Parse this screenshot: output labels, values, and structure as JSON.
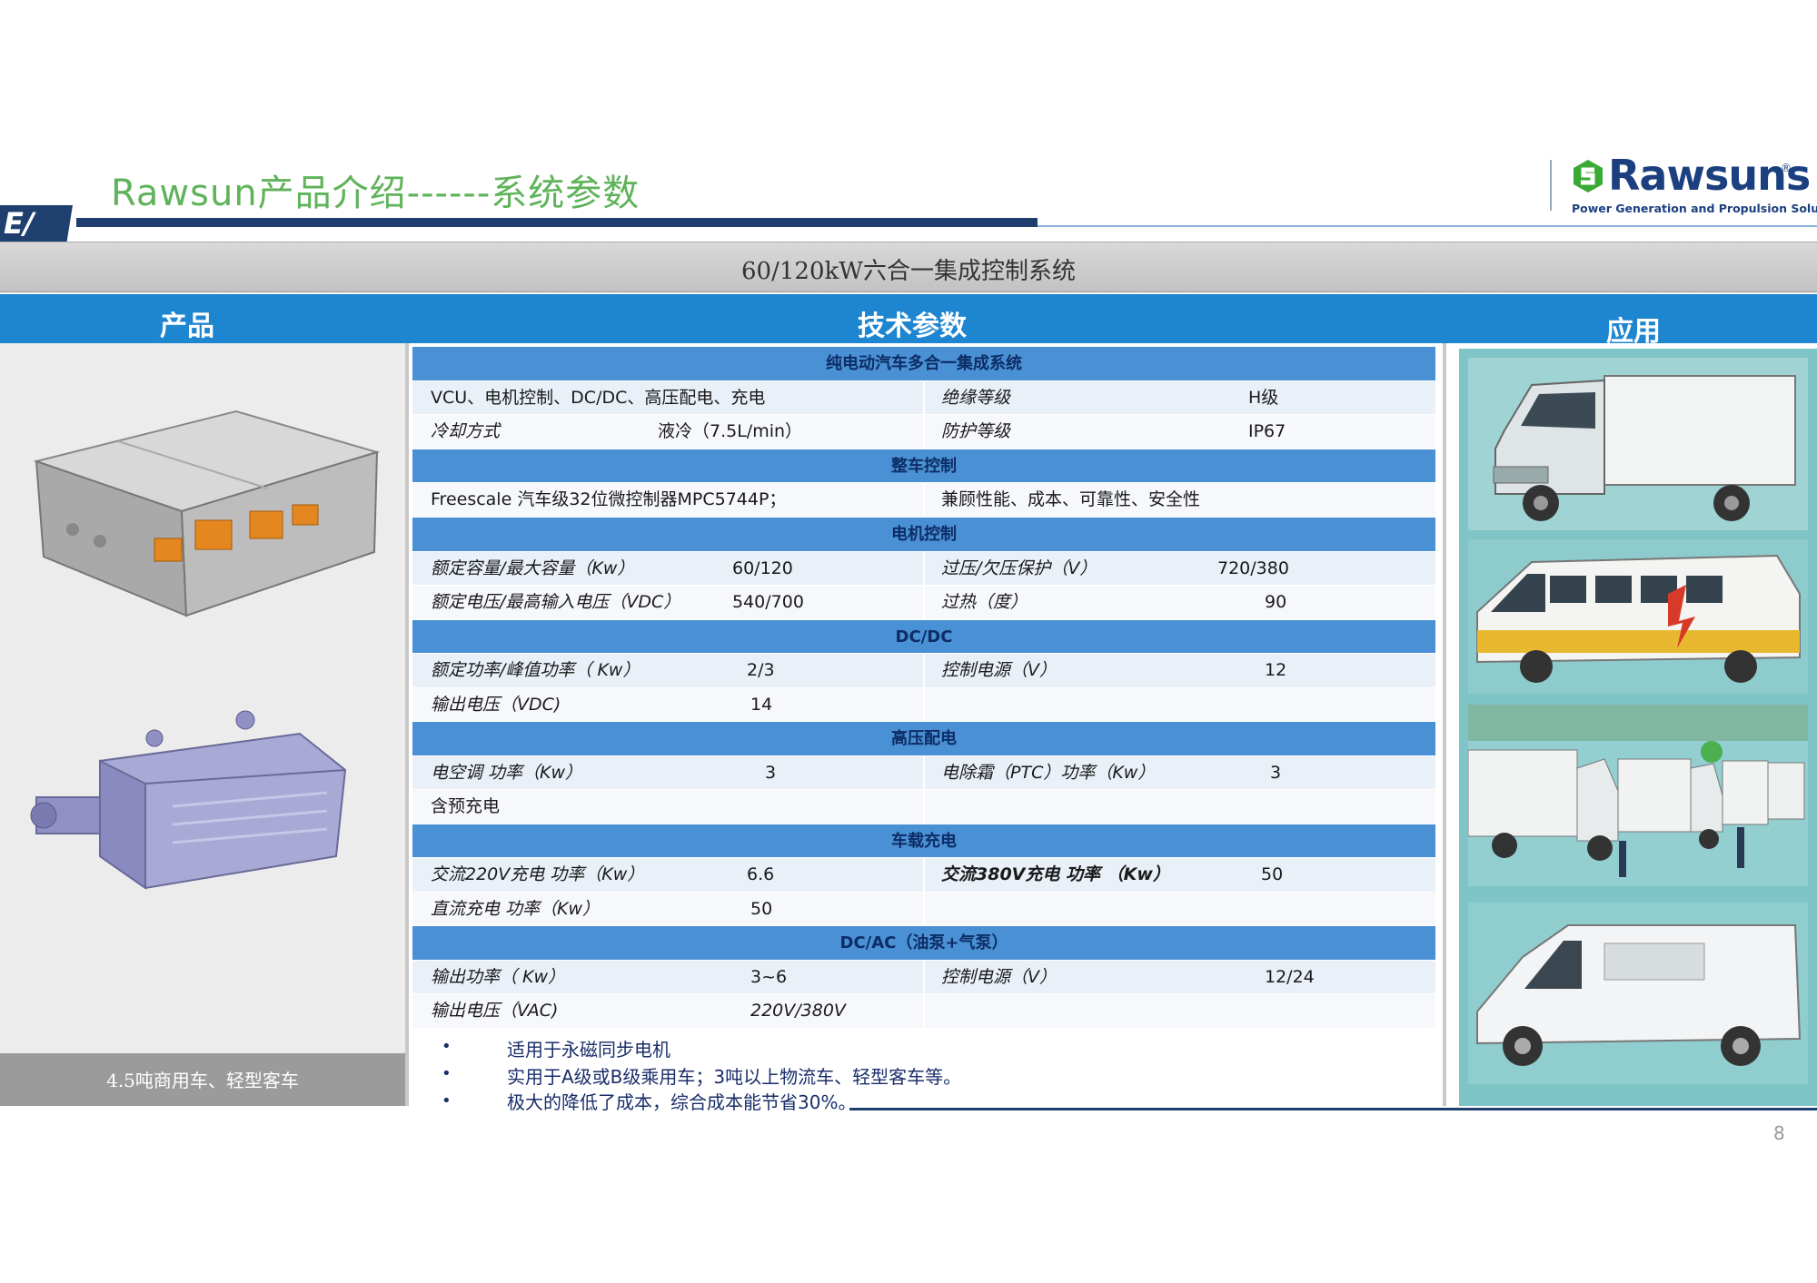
{
  "header": {
    "title": "Rawsun产品介绍------系统参数",
    "ev_mark": "E/",
    "logo": {
      "name": "Rawsuns",
      "reg": "®",
      "tagline": "Power Generation and Propulsion Solutions"
    }
  },
  "system_title": "60/120kW六合一集成控制系统",
  "columns": {
    "product": "产品",
    "tech": "技术参数",
    "application": "应用"
  },
  "product": {
    "caption": "4.5吨商用车、轻型客车"
  },
  "table": {
    "sec1": {
      "title": "纯电动汽车多合一集成系统",
      "r1": {
        "a": "VCU、电机控制、DC/DC、高压配电、充电",
        "c": "绝缘等级",
        "d": "H级"
      },
      "r2": {
        "a": "冷却方式",
        "b": "液冷（7.5L/min）",
        "c": "防护等级",
        "d": "IP67"
      }
    },
    "sec2": {
      "title": "整车控制",
      "r1": {
        "a": "Freescale 汽车级32位微控制器MPC5744P；",
        "c": "兼顾性能、成本、可靠性、安全性"
      }
    },
    "sec3": {
      "title": "电机控制",
      "r1": {
        "a": "额定容量/最大容量（Kw）",
        "b": "60/120",
        "c": "过压/欠压保护（V）",
        "d": "720/380"
      },
      "r2": {
        "a": "额定电压/最高输入电压（VDC）",
        "b": "540/700",
        "c": "过热（度）",
        "d": "90"
      }
    },
    "sec4": {
      "title": "DC/DC",
      "r1": {
        "a": "额定功率/峰值功率（ Kw）",
        "b": "2/3",
        "c": "控制电源（V）",
        "d": "12"
      },
      "r2": {
        "a": "输出电压（VDC)",
        "b": "14"
      }
    },
    "sec5": {
      "title": "高压配电",
      "r1": {
        "a": "电空调 功率（Kw）",
        "b": "3",
        "c": "电除霜（PTC）功率（Kw）",
        "d": "3"
      },
      "r2": {
        "a": "含预充电"
      }
    },
    "sec6": {
      "title": "车载充电",
      "r1": {
        "a": "交流220V充电 功率（Kw）",
        "b": "6.6",
        "c": "交流380V充电 功率 （Kw）",
        "d": "50"
      },
      "r2": {
        "a": "直流充电 功率（Kw）",
        "b": "50"
      }
    },
    "sec7": {
      "title": "DC/AC（油泵+气泵）",
      "r1": {
        "a": "输出功率（ Kw）",
        "b": "3~6",
        "c": "控制电源（V）",
        "d": "12/24"
      },
      "r2": {
        "a": "输出电压（VAC)",
        "b": "220V/380V"
      }
    }
  },
  "bullets": [
    "适用于永磁同步电机",
    "实用于A级或B级乘用车；3吨以上物流车、轻型客车等。",
    "极大的降低了成本，综合成本能节省30%。"
  ],
  "bullet_mark": "•",
  "page_number": "8",
  "colors": {
    "accent_blue": "#1e86d0",
    "section_blue": "#4a90d4",
    "navy": "#1f3f6e",
    "title_green": "#5fb35a",
    "logo_navy": "#1c3f80",
    "teal": "#7fc4c6"
  }
}
